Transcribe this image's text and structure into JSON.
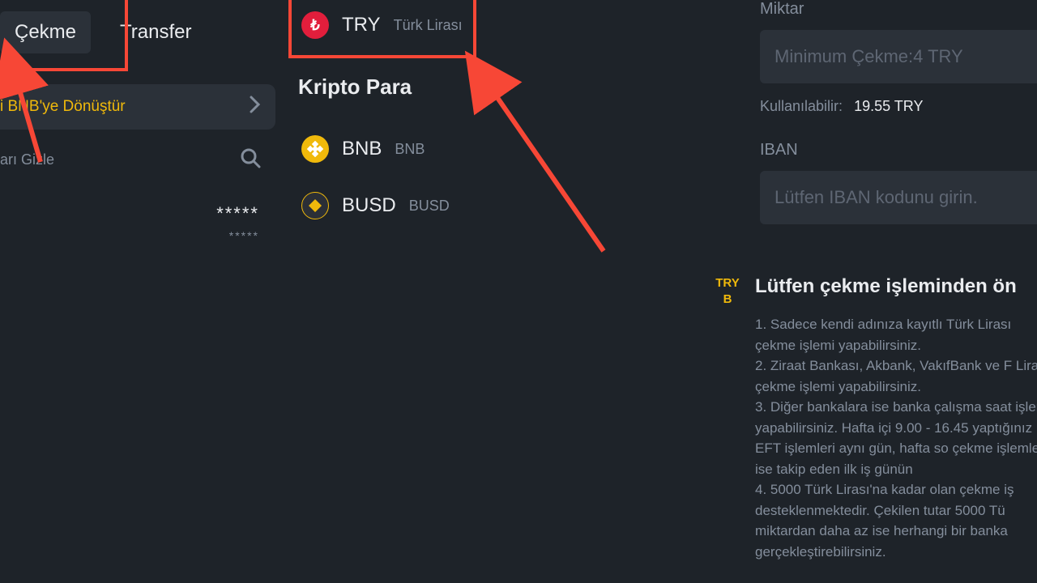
{
  "tabs": {
    "withdraw": "Çekme",
    "transfer": "Transfer"
  },
  "convert": {
    "text": "i BNB'ye Dönüştür"
  },
  "hide": {
    "text": "arı Gizle"
  },
  "stars": {
    "line1": "*****",
    "line2": "*****"
  },
  "currency": {
    "try": {
      "symbol": "TRY",
      "name": "Türk Lirası",
      "glyph": "₺"
    },
    "section": "Kripto Para",
    "bnb": {
      "symbol": "BNB",
      "name": "BNB"
    },
    "busd": {
      "symbol": "BUSD",
      "name": "BUSD"
    }
  },
  "form": {
    "amount_label": "Miktar",
    "amount_placeholder": "Minimum Çekme:4 TRY",
    "available_label": "Kullanılabilir:",
    "available_value": "19.55 TRY",
    "iban_label": "IBAN",
    "iban_placeholder": "Lütfen IBAN kodunu girin."
  },
  "notice": {
    "badge1": "TRY",
    "badge2": "B",
    "title": "Lütfen çekme işleminden ön",
    "body": "1. Sadece kendi adınıza kayıtlı Türk Lirası çekme işlemi yapabilirsiniz.\n2. Ziraat Bankası, Akbank, VakıfBank ve F Lirası çekme işlemi yapabilirsiniz.\n3. Diğer bankalara ise banka çalışma saat işlemi yapabilirsiniz. Hafta içi 9.00 - 16.45 yaptığınız EFT işlemleri aynı gün, hafta so çekme işlemleri ise takip eden ilk iş günün\n4. 5000 Türk Lirası'na kadar olan çekme iş desteklenmektedir. Çekilen tutar 5000 Tü miktardan daha az ise herhangi bir banka gerçekleştirebilirsiniz."
  }
}
